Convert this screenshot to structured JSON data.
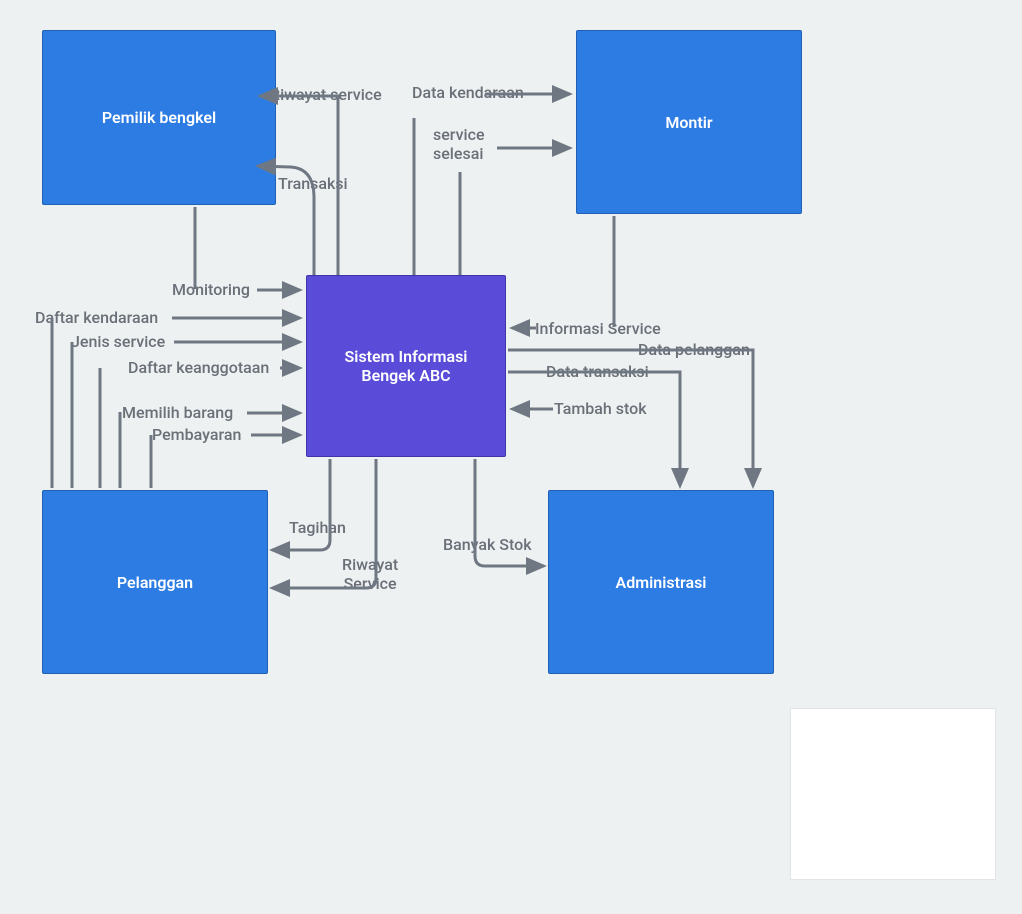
{
  "nodes": {
    "owner": "Pemilik bengkel",
    "montir": "Montir",
    "system_l1": "Sistem Informasi",
    "system_l2": "Bengek ABC",
    "customer": "Pelanggan",
    "admin": "Administrasi"
  },
  "labels": {
    "riwayat_service_top": "Riwayat service",
    "data_kendaraan": "Data kendaraan",
    "service_selesai_l1": "service",
    "service_selesai_l2": "selesai",
    "transaksi": "Transaksi",
    "monitoring": "Monitoring",
    "daftar_kendaraan": "Daftar kendaraan",
    "jenis_service": "Jenis service",
    "daftar_keanggotaan": "Daftar keanggotaan",
    "memilih_barang": "Memilih barang",
    "pembayaran": "Pembayaran",
    "informasi_service": "Informasi Service",
    "data_pelanggan": "Data pelanggan",
    "data_transaksi": "Data transaksi",
    "tambah_stok": "Tambah stok",
    "tagihan": "Tagihan",
    "riwayat_service_bottom_l1": "Riwayat",
    "riwayat_service_bottom_l2": "Service",
    "banyak_stok": "Banyak Stok"
  },
  "colors": {
    "blue": "#2c7ce4",
    "purple": "#5a4cd9",
    "arrow": "#6f7882",
    "bg": "#eef1f2"
  }
}
